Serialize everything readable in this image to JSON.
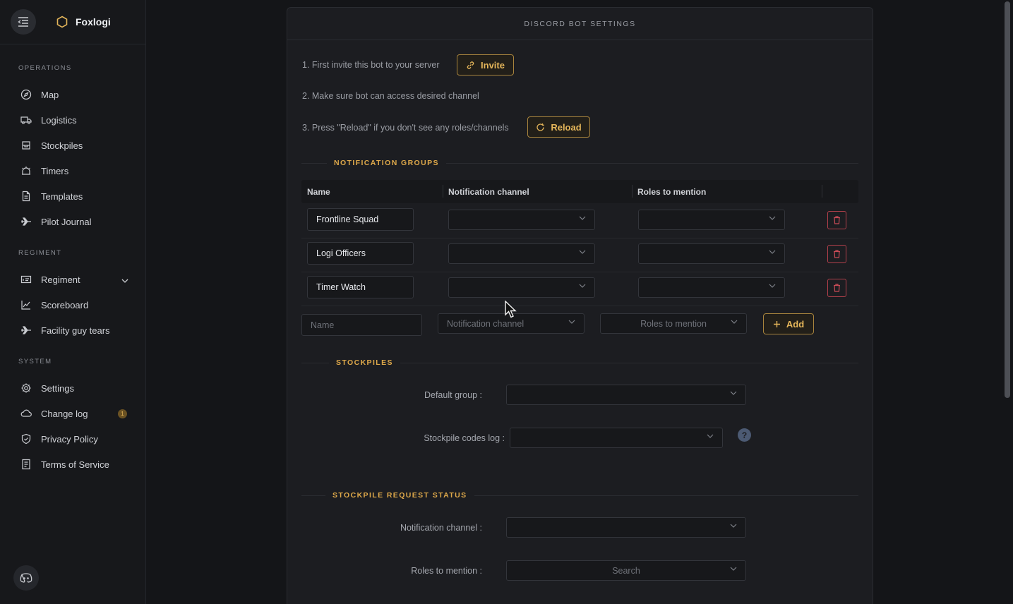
{
  "app": {
    "name": "Foxlogi"
  },
  "sidebar": {
    "sections": [
      {
        "label": "OPERATIONS"
      },
      {
        "label": "REGIMENT"
      },
      {
        "label": "SYSTEM"
      }
    ],
    "items": [
      {
        "label": "Map",
        "icon": "compass-icon"
      },
      {
        "label": "Logistics",
        "icon": "truck-icon"
      },
      {
        "label": "Stockpiles",
        "icon": "box-icon"
      },
      {
        "label": "Timers",
        "icon": "alarm-icon"
      },
      {
        "label": "Templates",
        "icon": "document-icon"
      },
      {
        "label": "Pilot Journal",
        "icon": "plane-icon"
      },
      {
        "label": "Regiment",
        "icon": "id-card-icon"
      },
      {
        "label": "Scoreboard",
        "icon": "chart-line-icon"
      },
      {
        "label": "Facility guy tears",
        "icon": "plane-icon"
      },
      {
        "label": "Settings",
        "icon": "gear-icon"
      },
      {
        "label": "Change log",
        "icon": "cloud-icon",
        "badge": "1"
      },
      {
        "label": "Privacy Policy",
        "icon": "shield-icon"
      },
      {
        "label": "Terms of Service",
        "icon": "document-list-icon"
      }
    ]
  },
  "panel": {
    "title": "DISCORD BOT SETTINGS",
    "steps": [
      "1. First invite this bot to your server",
      "2. Make sure bot can access desired channel",
      "3. Press \"Reload\" if you don't see any roles/channels"
    ],
    "invite_label": "Invite",
    "reload_label": "Reload"
  },
  "notification_groups": {
    "title": "NOTIFICATION GROUPS",
    "columns": [
      "Name",
      "Notification channel",
      "Roles to mention"
    ],
    "rows": [
      {
        "name": "Frontline Squad"
      },
      {
        "name": "Logi Officers"
      },
      {
        "name": "Timer Watch"
      }
    ],
    "new_row": {
      "name_placeholder": "Name",
      "channel_placeholder": "Notification channel",
      "roles_placeholder": "Roles to mention",
      "add_label": "Add"
    }
  },
  "stockpiles": {
    "title": "STOCKPILES",
    "default_group_label": "Default group",
    "codes_log_label": "Stockpile codes log",
    "help_label": "?"
  },
  "request_status": {
    "title": "STOCKPILE REQUEST STATUS",
    "channel_label": "Notification channel",
    "roles_label": "Roles to mention",
    "roles_placeholder": "Search"
  },
  "colors": {
    "accent": "#dfa94a",
    "danger": "#b2404b",
    "background": "#141518",
    "panel": "#1c1d21"
  }
}
